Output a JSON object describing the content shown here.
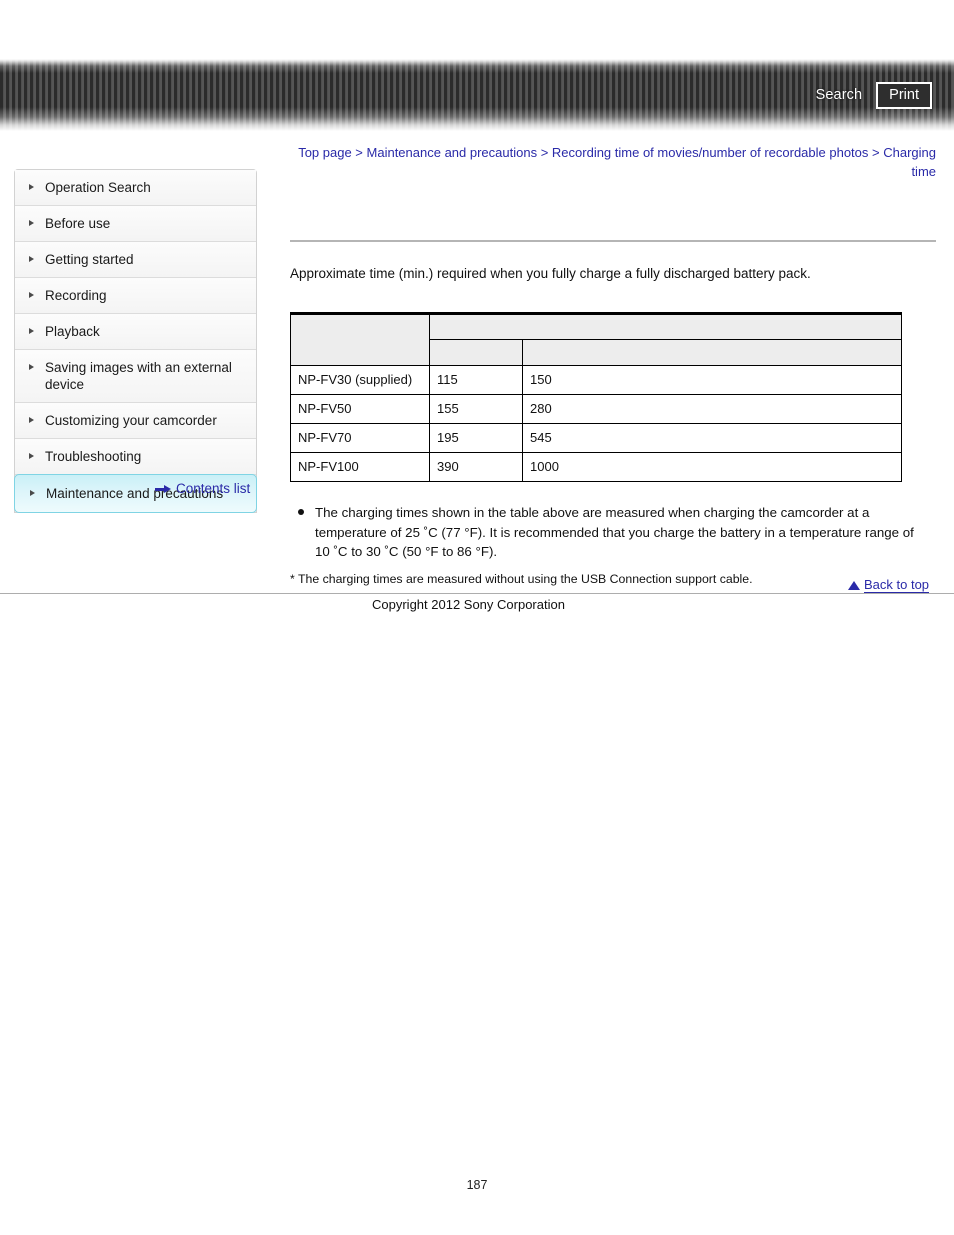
{
  "header": {
    "search_label": "Search",
    "print_label": "Print",
    "search_icon": "search-icon",
    "print_icon": "print-icon"
  },
  "breadcrumb": {
    "separator": " > ",
    "items": [
      "Top page",
      "Maintenance and precautions",
      "Recording time of movies/number of recordable photos",
      "Charging time"
    ]
  },
  "sidebar": {
    "bullet_icon": "triangle-right-icon",
    "active_index": 8,
    "items": [
      {
        "label": "Operation Search"
      },
      {
        "label": "Before use"
      },
      {
        "label": "Getting started"
      },
      {
        "label": "Recording"
      },
      {
        "label": "Playback"
      },
      {
        "label": "Saving images with an external device"
      },
      {
        "label": "Customizing your camcorder"
      },
      {
        "label": "Troubleshooting"
      },
      {
        "label": "Maintenance and precautions"
      }
    ],
    "contents_link": {
      "label": "Contents list",
      "icon": "arrow-right-icon"
    }
  },
  "main": {
    "intro": "Approximate time (min.) required when you fully charge a fully discharged battery pack.",
    "table": {
      "header_rows": [
        [
          "",
          ""
        ],
        [
          "",
          "",
          ""
        ]
      ],
      "rows": [
        [
          "NP-FV30 (supplied)",
          "115",
          "150"
        ],
        [
          "NP-FV50",
          "155",
          "280"
        ],
        [
          "NP-FV70",
          "195",
          "545"
        ],
        [
          "NP-FV100",
          "390",
          "1000"
        ]
      ]
    },
    "notes": {
      "bullet": "The charging times shown in the table above are measured when charging the camcorder at a temperature of 25 ˚C (77 °F). It is recommended that you charge the battery in a temperature range of 10 ˚C to 30 ˚C (50 °F to 86 °F).",
      "footnote": "* The charging times are measured without using the USB Connection support cable."
    }
  },
  "footer": {
    "back_to_top_label": "Back to top",
    "back_to_top_icon": "triangle-up-icon",
    "copyright": "Copyright 2012 Sony Corporation"
  },
  "page_number": "187",
  "colors": {
    "link": "#2a2aa8",
    "active_sidebar": "#c9f0f7",
    "table_header_bg": "#ededed"
  }
}
